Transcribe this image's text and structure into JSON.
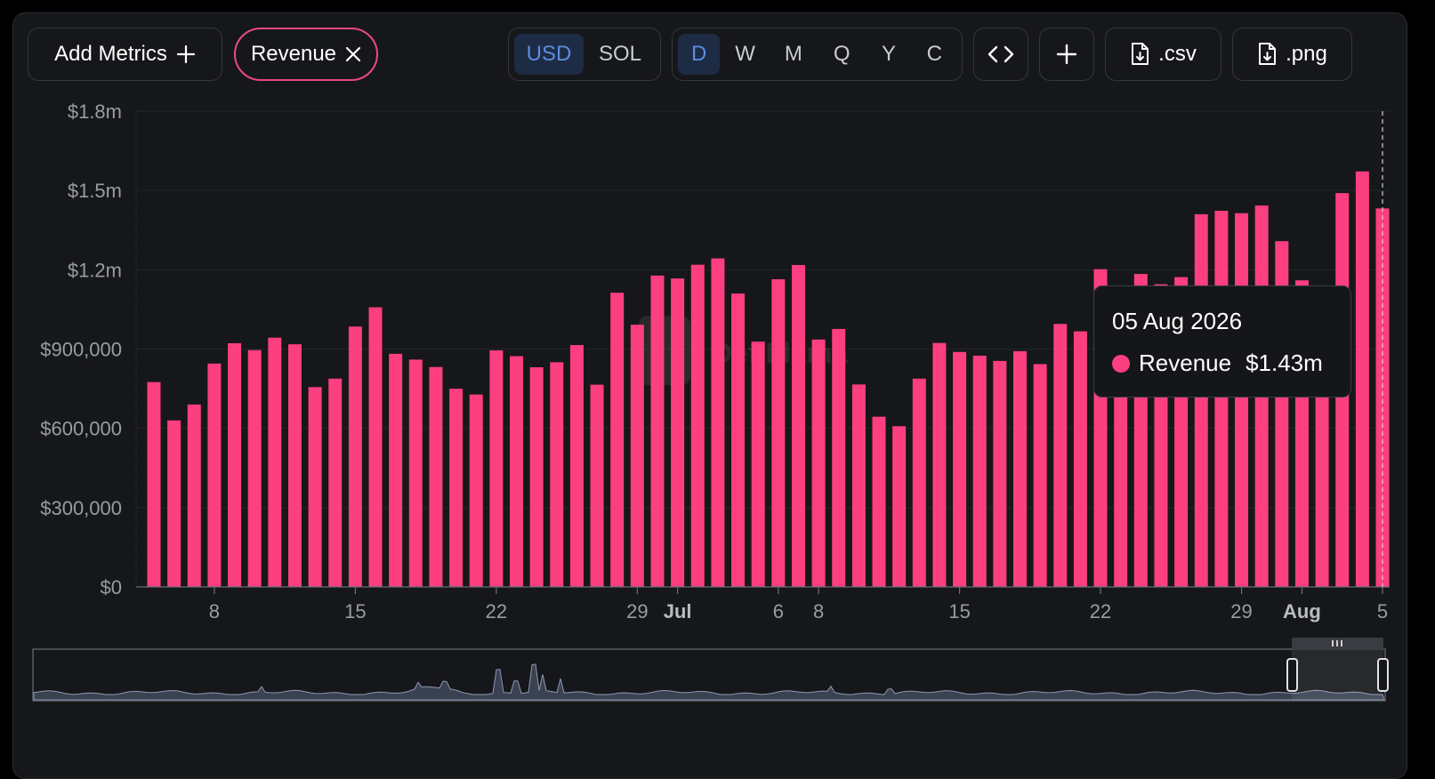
{
  "toolbar": {
    "add_metrics_label": "Add Metrics",
    "revenue_chip_label": "Revenue",
    "currency_options": [
      "USD",
      "SOL"
    ],
    "currency_selected": "USD",
    "period_options": [
      "D",
      "W",
      "M",
      "Q",
      "Y",
      "C"
    ],
    "period_selected": "D",
    "csv_label": ".csv",
    "png_label": ".png"
  },
  "tooltip": {
    "date": "05 Aug 2026",
    "series": "Revenue",
    "value": "$1.43m"
  },
  "watermark": "DefiLlama",
  "colors": {
    "series": "#fc3f7e",
    "accent": "#5b8de0",
    "chip_border": "#e84a80"
  },
  "chart_data": {
    "type": "bar",
    "series": [
      {
        "name": "Revenue",
        "values": [
          775000,
          630000,
          690000,
          845000,
          922000,
          896000,
          943000,
          918000,
          756000,
          788000,
          985000,
          1058000,
          882000,
          860000,
          832000,
          750000,
          728000,
          895000,
          873000,
          831000,
          850000,
          915000,
          765000,
          1113000,
          992000,
          1178000,
          1167000,
          1219000,
          1243000,
          1110000,
          928000,
          1164000,
          1218000,
          936000,
          976000,
          766000,
          644000,
          608000,
          788000,
          923000,
          889000,
          875000,
          855000,
          892000,
          843000,
          995000,
          967000,
          1202000,
          1140000,
          1184000,
          1145000,
          1172000,
          1410000,
          1423000,
          1414000,
          1443000,
          1308000,
          1160000,
          1100000,
          1490000,
          1572000,
          1432000
        ]
      }
    ],
    "x_tick_labels": [
      {
        "index": 3,
        "label": "8",
        "bold": false
      },
      {
        "index": 10,
        "label": "15",
        "bold": false
      },
      {
        "index": 17,
        "label": "22",
        "bold": false
      },
      {
        "index": 24,
        "label": "29",
        "bold": false
      },
      {
        "index": 26,
        "label": "Jul",
        "bold": true
      },
      {
        "index": 31,
        "label": "6",
        "bold": false
      },
      {
        "index": 33,
        "label": "8",
        "bold": false
      },
      {
        "index": 40,
        "label": "15",
        "bold": false
      },
      {
        "index": 47,
        "label": "22",
        "bold": false
      },
      {
        "index": 54,
        "label": "29",
        "bold": false
      },
      {
        "index": 57,
        "label": "Aug",
        "bold": true
      },
      {
        "index": 61,
        "label": "5",
        "bold": false
      }
    ],
    "y_ticks": [
      0,
      300000,
      600000,
      900000,
      1200000,
      1500000,
      1800000
    ],
    "y_tick_labels": [
      "$0",
      "$300,000",
      "$600,000",
      "$900,000",
      "$1.2m",
      "$1.5m",
      "$1.8m"
    ],
    "ylim": [
      0,
      1800000
    ],
    "grid": true,
    "hover_index": 61
  }
}
